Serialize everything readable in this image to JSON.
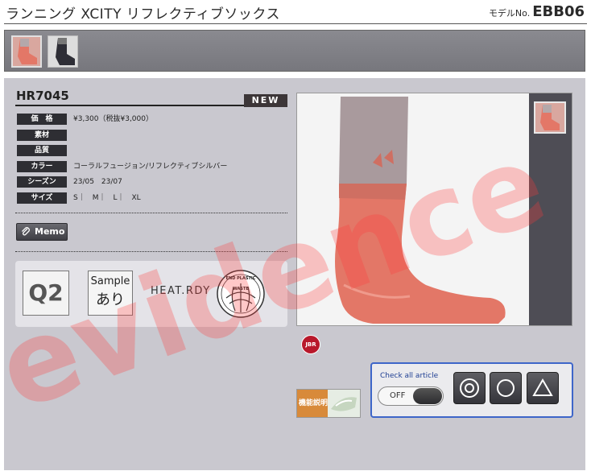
{
  "header": {
    "title": "ランニング XCITY リフレクティブソックス",
    "model_label": "モデルNo.",
    "model_number": "EBB06"
  },
  "product": {
    "code": "HR7045",
    "badge": "NEW",
    "specs": [
      {
        "label": "価　格",
        "value": "¥3,300（税抜¥3,000）"
      },
      {
        "label": "素材",
        "value": ""
      },
      {
        "label": "品質",
        "value": ""
      },
      {
        "label": "カラー",
        "value": "コーラルフュージョン/リフレクティブシルバー"
      },
      {
        "label": "シーズン",
        "value": "23/05　23/07"
      },
      {
        "label": "サイズ",
        "value": "S｜　M｜　L｜　XL"
      }
    ],
    "memo_label": "Memo",
    "feature_badges": {
      "quality": "Q2",
      "sample_line1": "Sample",
      "sample_line2": "あり",
      "heat": "HEAT.RDY",
      "plastic_top": "END PLASTIC",
      "plastic_bottom": "WASTE"
    },
    "jbr_label": "JBR",
    "function_label": "機能説明"
  },
  "check_panel": {
    "title": "Check all article",
    "toggle_state": "OFF"
  },
  "watermark": {
    "text": "evidence",
    "color": "#ff3b3b"
  },
  "colors": {
    "sock_coral": "#e37767",
    "sock_gray": "#a99a9d",
    "panel_bg": "#c9c8cf",
    "accent_blue": "#3e66c9"
  }
}
